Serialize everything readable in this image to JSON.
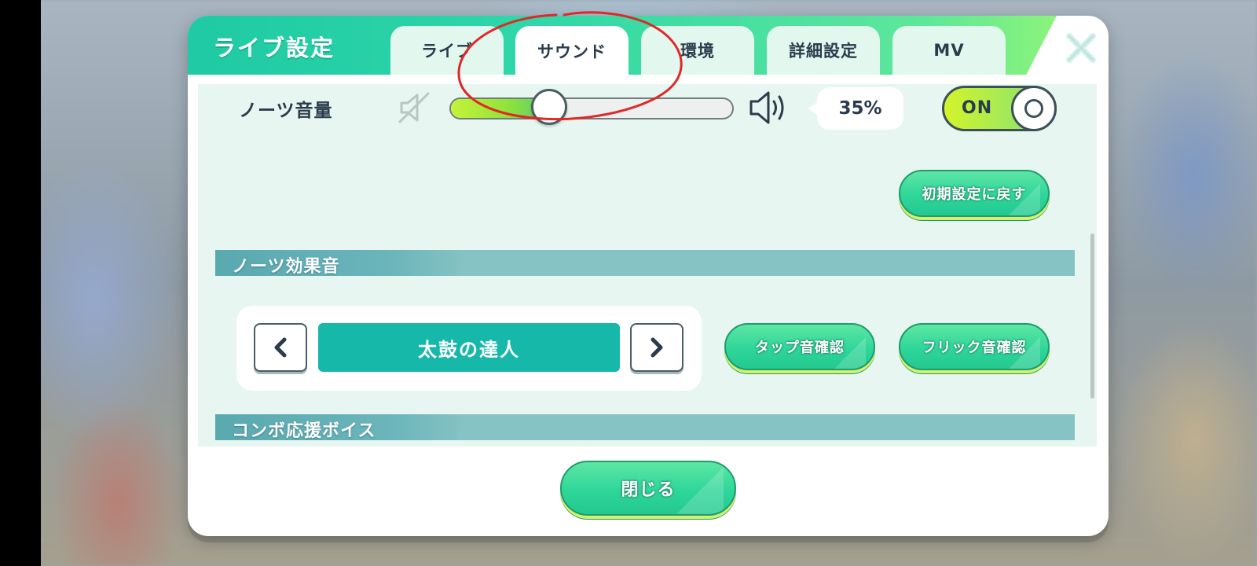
{
  "dialog": {
    "title": "ライブ設定",
    "tabs": [
      {
        "label": "ライブ",
        "active": false
      },
      {
        "label": "サウンド",
        "active": true
      },
      {
        "label": "環境",
        "active": false
      },
      {
        "label": "詳細設定",
        "active": false
      },
      {
        "label": "MV",
        "active": false
      }
    ],
    "close_icon": "close-icon"
  },
  "notes_volume": {
    "label": "ノーツ音量",
    "value_percent": 35,
    "display": "35%",
    "toggle_label": "ON",
    "toggle_on": true
  },
  "reset_button": "初期設定に戻す",
  "sections": {
    "notes_se": "ノーツ効果音",
    "combo_voice": "コンボ応援ボイス"
  },
  "se_selector": {
    "value": "太鼓の達人",
    "prev_icon": "chevron-left-icon",
    "next_icon": "chevron-right-icon"
  },
  "tap_check_button": "タップ音確認",
  "flick_check_button": "フリック音確認",
  "close_button": "閉じる",
  "colors": {
    "header_green": "#2fd7a8",
    "selector_teal": "#16b8aa",
    "section_bar": "#86c3c4",
    "annotation_red": "#e02828"
  }
}
